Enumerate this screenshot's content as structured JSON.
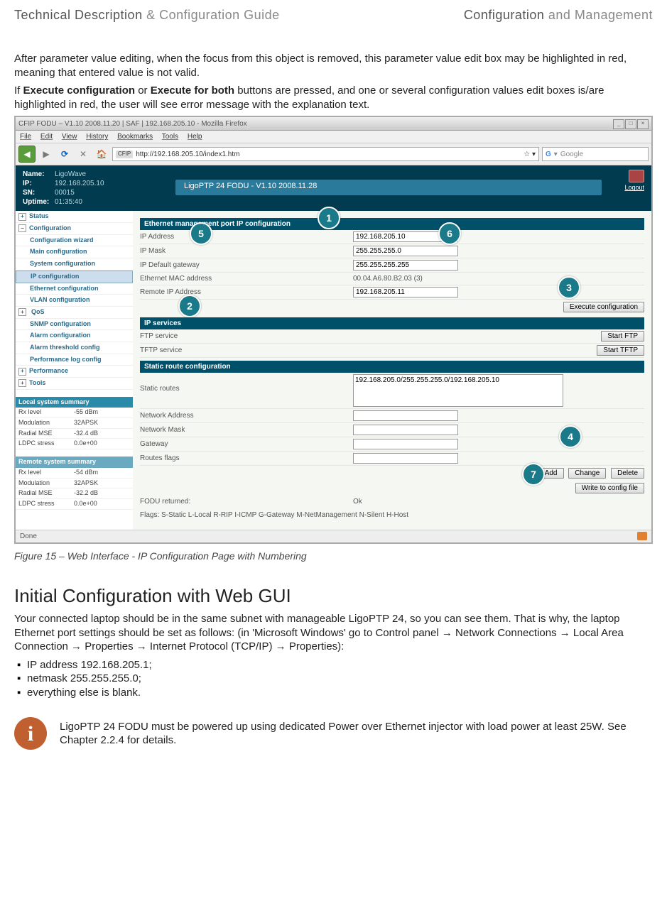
{
  "header": {
    "left_dark": "Technical Description",
    "left_grey": " & Configuration Guide",
    "right_dark": "Configuration",
    "right_grey": " and Management"
  },
  "para1": "After parameter value editing, when the focus from this object is removed, this parameter value edit box may be highlighted in red, meaning that entered value is not valid.",
  "para2_pre": "If ",
  "para2_b1": "Execute configuration",
  "para2_mid": " or ",
  "para2_b2": "Execute for both",
  "para2_post": " buttons are pressed, and one or several configuration values edit boxes is/are highlighted in red, the user will see error message with the explanation text.",
  "window": {
    "title": "CFIP FODU – V1.10 2008.11.20 | SAF | 192.168.205.10 - Mozilla Firefox",
    "menu": [
      "File",
      "Edit",
      "View",
      "History",
      "Bookmarks",
      "Tools",
      "Help"
    ],
    "url_tag": "CFIP",
    "url": "http://192.168.205.10/index1.htm",
    "search_placeholder": "Google",
    "dev": {
      "name_lbl": "Name:",
      "name": "LigoWave",
      "ip_lbl": "IP:",
      "ip": "192.168.205.10",
      "sn_lbl": "SN:",
      "sn": "00015",
      "up_lbl": "Uptime:",
      "uptime": "01:35:40"
    },
    "prod_title": "LigoPTP 24 FODU - V1.10 2008.11.28",
    "logout": "Logout",
    "tree": {
      "status": "Status",
      "config": "Configuration",
      "wizard": "Configuration wizard",
      "main": "Main configuration",
      "system": "System configuration",
      "ip": "IP configuration",
      "eth": "Ethernet configuration",
      "vlan": "VLAN configuration",
      "qos": "QoS",
      "snmp": "SNMP configuration",
      "alarm": "Alarm configuration",
      "thresh": "Alarm threshold config",
      "perf": "Performance log config",
      "performance": "Performance",
      "tools": "Tools"
    },
    "local_hdr": "Local system summary",
    "remote_hdr": "Remote system summary",
    "summary": {
      "rx_lbl": "Rx level",
      "mod_lbl": "Modulation",
      "mse_lbl": "Radial MSE",
      "ldpc_lbl": "LDPC stress",
      "local": {
        "rx": "-55 dBm",
        "mod": "32APSK",
        "mse": "-32.4 dB",
        "ldpc": "0.0e+00"
      },
      "remote": {
        "rx": "-54 dBm",
        "mod": "32APSK",
        "mse": "-32.2 dB",
        "ldpc": "0.0e+00"
      }
    },
    "sect1": "Ethernet management port IP configuration",
    "rows": {
      "ipaddr_lbl": "IP Address",
      "ipaddr": "192.168.205.10",
      "mask_lbl": "IP Mask",
      "mask": "255.255.255.0",
      "gw_lbl": "IP Default gateway",
      "gw": "255.255.255.255",
      "mac_lbl": "Ethernet MAC address",
      "mac": "00.04.A6.80.B2.03 (3)",
      "remote_lbl": "Remote IP Address",
      "remote": "192.168.205.11"
    },
    "exec_btn": "Execute configuration",
    "sect2": "IP services",
    "ftp_lbl": "FTP service",
    "ftp_btn": "Start FTP",
    "tftp_lbl": "TFTP service",
    "tftp_btn": "Start TFTP",
    "sect3": "Static route configuration",
    "routes_lbl": "Static routes",
    "routes_val": "192.168.205.0/255.255.255.0/192.168.205.10",
    "netaddr_lbl": "Network Address",
    "netmask_lbl": "Network Mask",
    "gateway_lbl": "Gateway",
    "flags_lbl": "Routes flags",
    "add_btn": "Add",
    "chg_btn": "Change",
    "del_btn": "Delete",
    "write_btn": "Write to config file",
    "fodu_lbl": "FODU returned:",
    "fodu_val": "Ok",
    "flags_text": "Flags: S-Static L-Local R-RIP I-ICMP G-Gateway M-NetManagement N-Silent H-Host",
    "statusbar": "Done"
  },
  "callouts": {
    "c1": "1",
    "c2": "2",
    "c3": "3",
    "c4": "4",
    "c5": "5",
    "c6": "6",
    "c7": "7"
  },
  "caption": "Figure 15 – Web Interface - IP Configuration Page with Numbering",
  "h2": "Initial Configuration with Web GUI",
  "para3": "Your connected laptop should be in the same subnet with manageable LigoPTP 24, so you can see them. That is why, the laptop Ethernet port settings should be set as follows: (in 'Microsoft Windows' go to Control panel → Network Connections → Local Area Connection → Properties → Internet Protocol (TCP/IP) → Properties):",
  "bullets": {
    "b1": "IP address 192.168.205.1;",
    "b2": "netmask 255.255.255.0;",
    "b3": "everything else is blank."
  },
  "info_i": "i",
  "note": "LigoPTP 24 FODU must be powered up using dedicated Power over Ethernet injector with load power at least 25W. See Chapter 2.2.4 for details."
}
